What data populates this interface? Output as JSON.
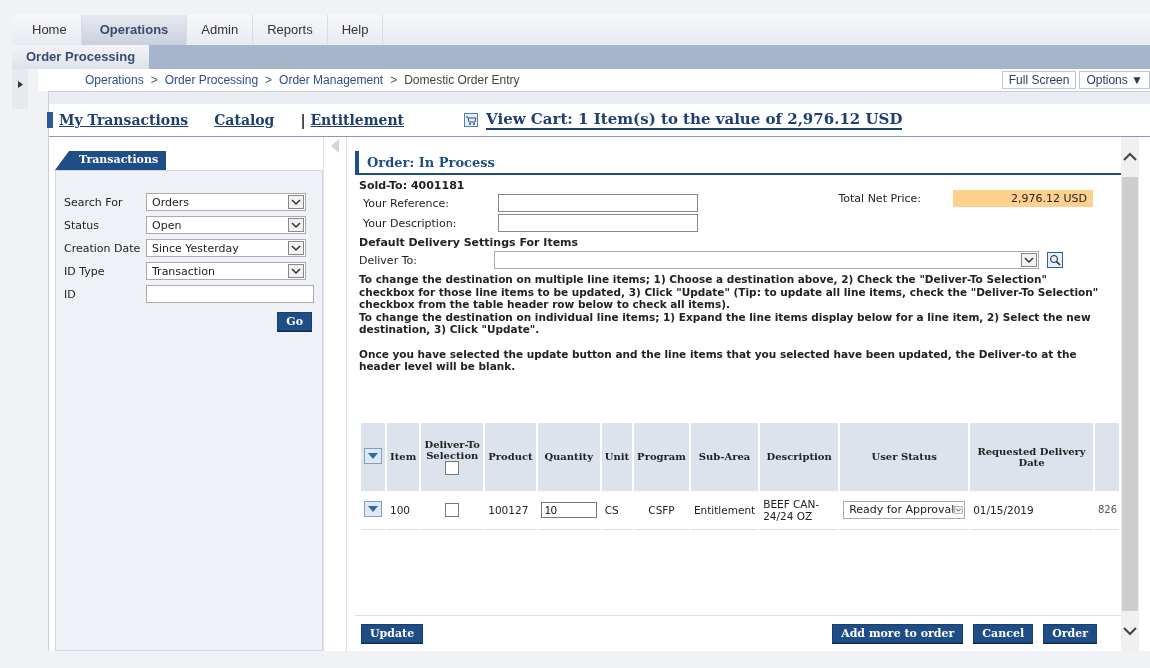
{
  "top_tabs": [
    {
      "label": "Home",
      "selected": false
    },
    {
      "label": "Operations",
      "selected": true
    },
    {
      "label": "Admin",
      "selected": false
    },
    {
      "label": "Reports",
      "selected": false
    },
    {
      "label": "Help",
      "selected": false
    }
  ],
  "sub_tabs": [
    {
      "label": "Order Processing",
      "selected": true
    }
  ],
  "breadcrumb": [
    {
      "label": "Operations",
      "kind": "link"
    },
    {
      "label": ">",
      "kind": "separator"
    },
    {
      "label": "Order Processing",
      "kind": "link"
    },
    {
      "label": ">",
      "kind": "separator"
    },
    {
      "label": "Order Management",
      "kind": "link"
    },
    {
      "label": ">",
      "kind": "separator"
    },
    {
      "label": "Domestic Order Entry",
      "kind": "current"
    }
  ],
  "header_buttons": [
    "Full Screen",
    "Options ▼"
  ],
  "nav_links": [
    {
      "label": "My Transactions",
      "kind": "link",
      "selected": true
    },
    {
      "label": "Catalog",
      "kind": "link",
      "selected": false
    },
    {
      "label": "| ",
      "kind": "separator"
    },
    {
      "label": "Entitlement",
      "kind": "link",
      "selected": false
    },
    {
      "label": "View Cart: 1 Item(s) to the value of 2,976.12 USD",
      "kind": "cart",
      "selected": false
    }
  ],
  "sidebar": {
    "tab": "Transactions",
    "fields": [
      {
        "label": "Search For",
        "kind": "select",
        "value": "Orders"
      },
      {
        "label": "Status",
        "kind": "select",
        "value": "Open"
      },
      {
        "label": "Creation Date",
        "kind": "select",
        "value": "Since Yesterday"
      },
      {
        "label": "ID Type",
        "kind": "select",
        "value": "Transaction"
      },
      {
        "label": "ID",
        "kind": "input"
      }
    ],
    "button": "Go"
  },
  "order": {
    "title": "Order: In Process",
    "sold_to": "Sold-To: 4001181",
    "total_label": "Total Net Price:",
    "total_value": "2,976.12 USD",
    "fields": [
      {
        "label": "Your Reference:"
      },
      {
        "label": "Your Description:"
      }
    ],
    "delivery_heading": "Default Delivery Settings For Items",
    "deliver_to_label": "Deliver To:",
    "instructions": [
      {
        "text": "To change the destination on multiple line items; 1) Choose a destination above, 2) Check the \"Deliver-To Selection\" checkbox for those line items to be updated, 3) Click \"Update\" (Tip: to update all line items, check the \"Deliver-To Selection\" checkbox from the table header row below to check all items).",
        "spaced": false
      },
      {
        "text": "To change the destination on individual line items; 1) Expand the line items display below for a line item, 2) Select the new destination, 3) Click \"Update\".",
        "spaced": false
      },
      {
        "text": "Once you have selected the update button and the line items that you selected have been updated, the Deliver-to at the header level will be blank.",
        "spaced": true
      }
    ]
  },
  "table": {
    "header_checked": false,
    "columns": [
      "Item",
      "Deliver-To Selection",
      "Product",
      "Quantity",
      "Unit",
      "Program",
      "Sub-Area",
      "Description",
      "User Status",
      "Requested Delivery Date"
    ],
    "rows": [
      {
        "item": "100",
        "checked": false,
        "product": "100127",
        "quantity": "10",
        "unit": "CS",
        "program": "CSFP",
        "sub_area": "Entitlement",
        "description": "BEEF CAN-24/24 OZ",
        "user_status": "Ready for Approval",
        "date": "01/15/2019",
        "column_12": "826"
      }
    ]
  },
  "footer": {
    "left_buttons": [
      "Update"
    ],
    "right_buttons": [
      "Add more to order",
      "Cancel",
      "Order"
    ]
  }
}
